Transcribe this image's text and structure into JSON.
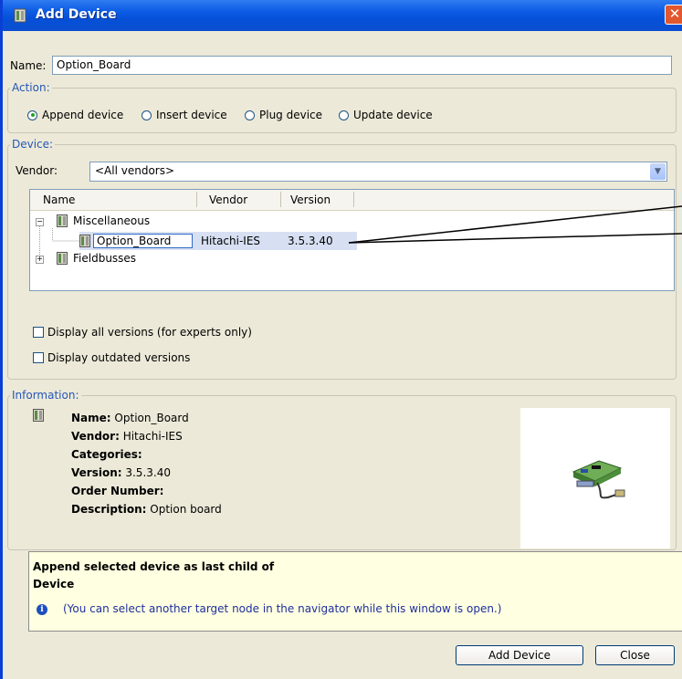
{
  "window": {
    "title": "Add Device",
    "close_glyph": "✕",
    "icon": "device-icon"
  },
  "name_field": {
    "label": "Name:",
    "value": "Option_Board"
  },
  "action": {
    "title": "Action:",
    "options": [
      {
        "label": "Append device",
        "selected": true
      },
      {
        "label": "Insert device",
        "selected": false
      },
      {
        "label": "Plug device",
        "selected": false
      },
      {
        "label": "Update device",
        "selected": false
      }
    ]
  },
  "device": {
    "title": "Device:",
    "vendor_label": "Vendor:",
    "vendor_value": "<All vendors>",
    "columns": [
      "Name",
      "Vendor",
      "Version"
    ],
    "tree": {
      "folder1": "Miscellaneous",
      "item": {
        "name": "Option_Board",
        "vendor": "Hitachi-IES",
        "version": "3.5.3.40"
      },
      "folder2": "Fieldbusses"
    },
    "expander_minus": "−",
    "expander_plus": "+",
    "checkbox_all_versions": "Display all versions (for experts only)",
    "checkbox_outdated": "Display outdated versions"
  },
  "information": {
    "title": "Information:",
    "name_label": "Name:",
    "name_value": "Option_Board",
    "vendor_label": "Vendor:",
    "vendor_value": "Hitachi-IES",
    "categories_label": "Categories:",
    "version_label": "Version:",
    "version_value": "3.5.3.40",
    "order_label": "Order Number:",
    "description_label": "Description:",
    "description_value": "Option board"
  },
  "note": {
    "line1": "Append selected device as last child of",
    "line2": "Device",
    "info_glyph": "i",
    "hint": "(You can select another target node in the navigator while this window is open.)"
  },
  "buttons": {
    "add": "Add Device",
    "close": "Close"
  },
  "colors": {
    "titlebar": "#0550d8",
    "group_title": "#2457b8",
    "note_bg": "#ffffe1",
    "selection": "#d7e0f3"
  }
}
